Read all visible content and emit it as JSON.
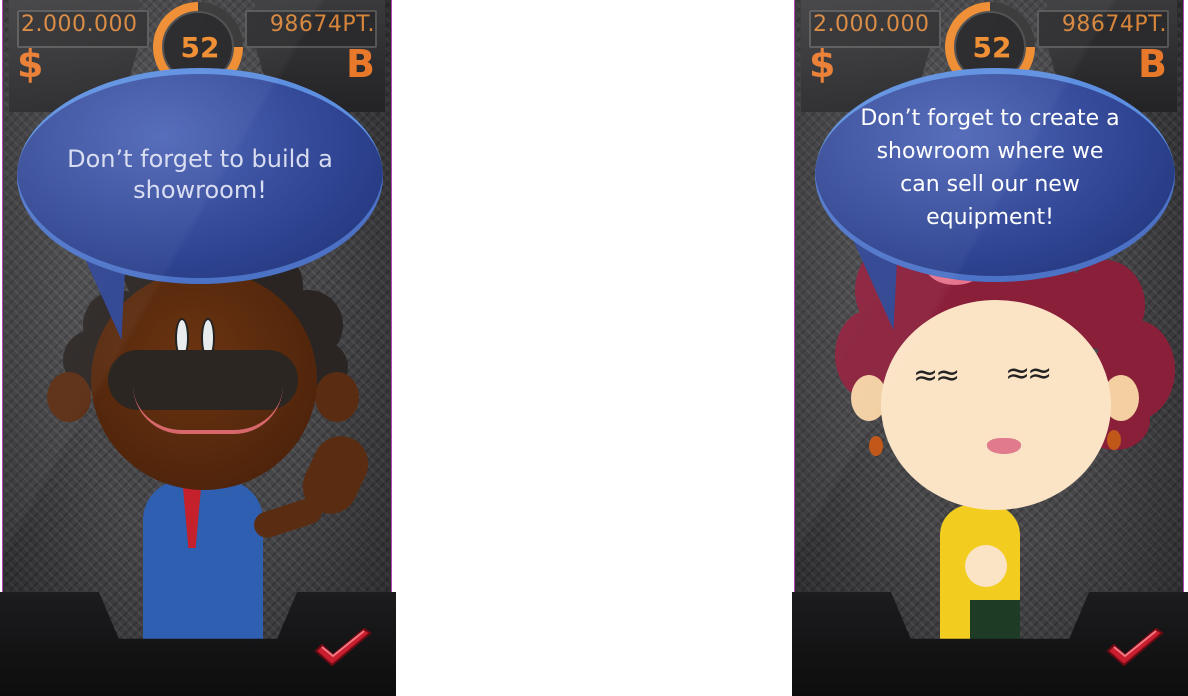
{
  "screens": [
    {
      "hud": {
        "money": "2.000.000",
        "currency_symbol": "$",
        "level": "52",
        "points": "98674PT.",
        "points_symbol": "B"
      },
      "dialog": {
        "message": "Don’t forget to build a showroom!"
      },
      "character_icon": "male-advisor-character",
      "confirm_icon": "check-icon"
    },
    {
      "hud": {
        "money": "2.000.000",
        "currency_symbol": "$",
        "level": "52",
        "points": "98674PT.",
        "points_symbol": "B"
      },
      "dialog": {
        "message": "Don’t forget to create a showroom where we can sell our new equipment!"
      },
      "character_icon": "female-advisor-character",
      "confirm_icon": "check-icon"
    }
  ],
  "colors": {
    "accent_orange": "#ee8a2c",
    "bubble_blue": "#2e4391",
    "check_red": "#c81e2e",
    "frame_border": "#b548b0"
  }
}
